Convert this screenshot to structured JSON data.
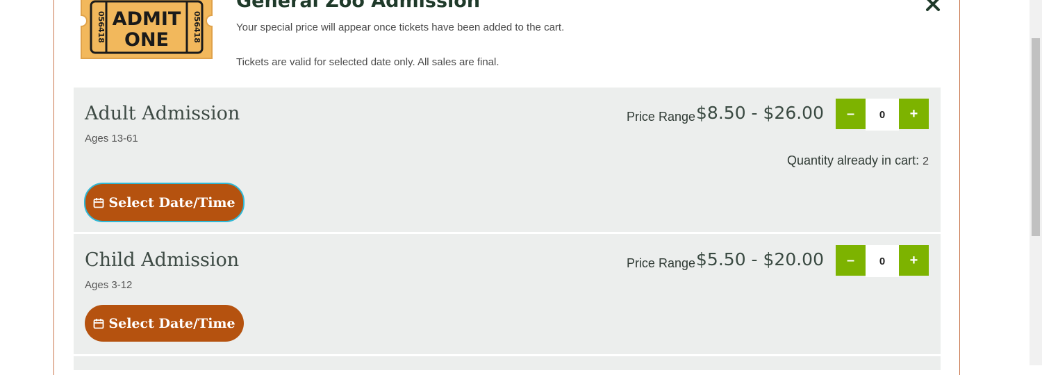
{
  "modal": {
    "title": "General Zoo Admission",
    "description_line1": "Your special price will appear once tickets have been added to the cart.",
    "description_line2": "Tickets are valid for selected date only. All sales are final.",
    "ticket_graphic": {
      "text_line1": "ADMIT",
      "text_line2": "ONE",
      "serial": "056418"
    },
    "close_icon": "close-icon"
  },
  "items": [
    {
      "title": "Adult Admission",
      "subtitle": "Ages 13-61",
      "price_label": "Price Range",
      "price_value": "$8.50 - $26.00",
      "minus": "–",
      "plus": "+",
      "quantity": "0",
      "cart_label": "Quantity already in cart:",
      "cart_count": "2",
      "date_button": "Select Date/Time"
    },
    {
      "title": "Child Admission",
      "subtitle": "Ages 3-12",
      "price_label": "Price Range",
      "price_value": "$5.50 - $20.00",
      "minus": "–",
      "plus": "+",
      "quantity": "0",
      "date_button": "Select Date/Time"
    }
  ],
  "colors": {
    "accent_green": "#7db300",
    "button_brown": "#b5520f",
    "focus_ring": "#2fb8d6",
    "row_background": "#eceeed",
    "ticket_yellow": "#f2b85c"
  }
}
